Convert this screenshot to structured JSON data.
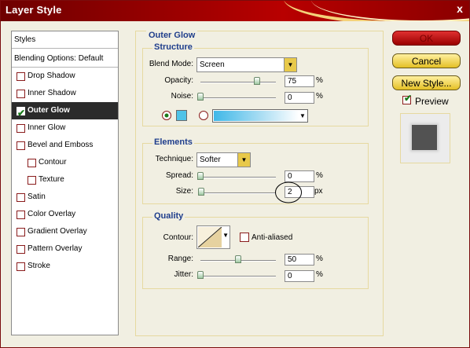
{
  "window": {
    "title": "Layer Style",
    "close_glyph": "x"
  },
  "styles_panel": {
    "header": "Styles",
    "items": [
      {
        "label": "Blending Options: Default",
        "checkbox": false,
        "checked": false
      },
      {
        "label": "Drop Shadow",
        "checkbox": true,
        "checked": false
      },
      {
        "label": "Inner Shadow",
        "checkbox": true,
        "checked": false
      },
      {
        "label": "Outer Glow",
        "checkbox": true,
        "checked": true,
        "selected": true
      },
      {
        "label": "Inner Glow",
        "checkbox": true,
        "checked": false
      },
      {
        "label": "Bevel and Emboss",
        "checkbox": true,
        "checked": false
      },
      {
        "label": "Contour",
        "checkbox": true,
        "checked": false,
        "indent": true
      },
      {
        "label": "Texture",
        "checkbox": true,
        "checked": false,
        "indent": true
      },
      {
        "label": "Satin",
        "checkbox": true,
        "checked": false
      },
      {
        "label": "Color Overlay",
        "checkbox": true,
        "checked": false
      },
      {
        "label": "Gradient Overlay",
        "checkbox": true,
        "checked": false
      },
      {
        "label": "Pattern Overlay",
        "checkbox": true,
        "checked": false
      },
      {
        "label": "Stroke",
        "checkbox": true,
        "checked": false
      }
    ]
  },
  "outer_glow": {
    "title": "Outer Glow",
    "structure": {
      "title": "Structure",
      "blend_mode_label": "Blend Mode:",
      "blend_mode_value": "Screen",
      "opacity_label": "Opacity:",
      "opacity_value": "75",
      "opacity_unit": "%",
      "opacity_fraction": 0.75,
      "noise_label": "Noise:",
      "noise_value": "0",
      "noise_unit": "%",
      "noise_fraction": 0.0,
      "glow_color": "#4fc3e8"
    },
    "elements": {
      "title": "Elements",
      "technique_label": "Technique:",
      "technique_value": "Softer",
      "spread_label": "Spread:",
      "spread_value": "0",
      "spread_unit": "%",
      "spread_fraction": 0.0,
      "size_label": "Size:",
      "size_value": "2",
      "size_unit": "px",
      "size_fraction": 0.01
    },
    "quality": {
      "title": "Quality",
      "contour_label": "Contour:",
      "anti_aliased_label": "Anti-aliased",
      "anti_aliased": false,
      "range_label": "Range:",
      "range_value": "50",
      "range_unit": "%",
      "range_fraction": 0.5,
      "jitter_label": "Jitter:",
      "jitter_value": "0",
      "jitter_unit": "%",
      "jitter_fraction": 0.0
    }
  },
  "buttons": {
    "ok": "OK",
    "cancel": "Cancel",
    "new_style": "New Style..."
  },
  "preview": {
    "label": "Preview",
    "checked": true,
    "swatch_color": "#525252"
  },
  "colors": {
    "title_bar": "#a50000",
    "accent_gold": "#e4c025",
    "heading_blue": "#1f3e8c"
  }
}
